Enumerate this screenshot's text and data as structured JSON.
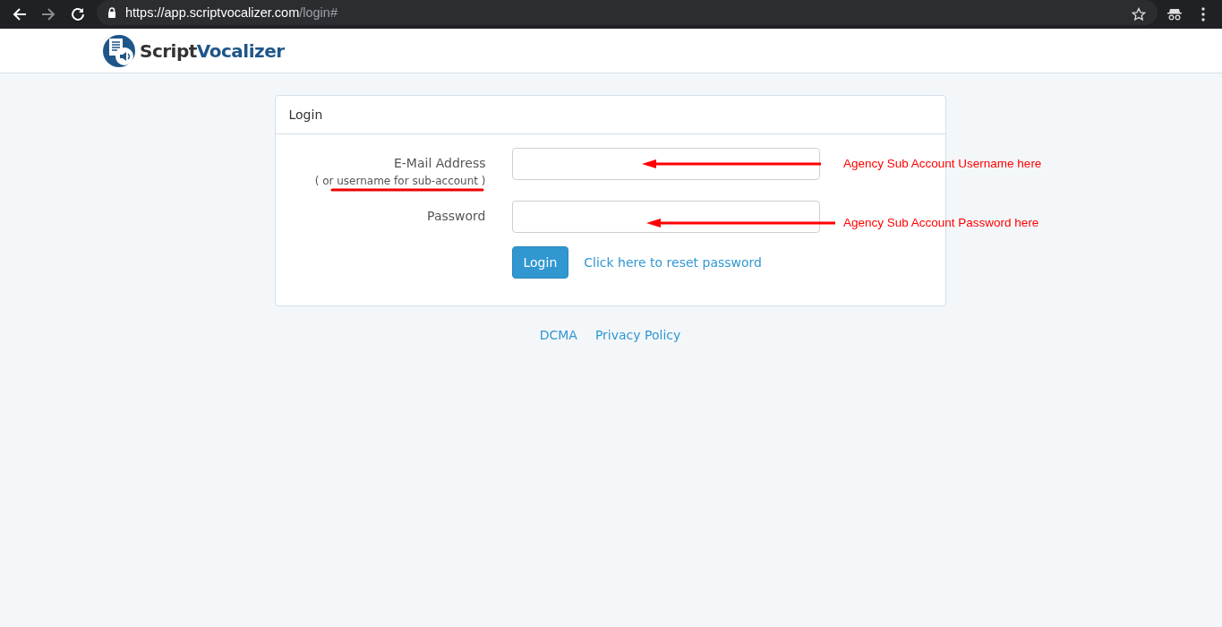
{
  "browser": {
    "url_host": "https://app.scriptvocalizer.com",
    "url_path": "/login#"
  },
  "logo": {
    "word_1": "Script",
    "word_2": "Vocalizer"
  },
  "login_card": {
    "title": "Login",
    "fields": [
      {
        "label": "E-Mail Address",
        "hint": "( or username for sub-account )"
      },
      {
        "label": "Password"
      }
    ],
    "button": "Login",
    "reset_link": "Click here to reset password"
  },
  "annotations": [
    {
      "text": "Agency Sub Account Username here"
    },
    {
      "text": "Agency Sub Account Password here"
    }
  ],
  "footer_links": [
    "DCMA",
    "Privacy Policy"
  ]
}
